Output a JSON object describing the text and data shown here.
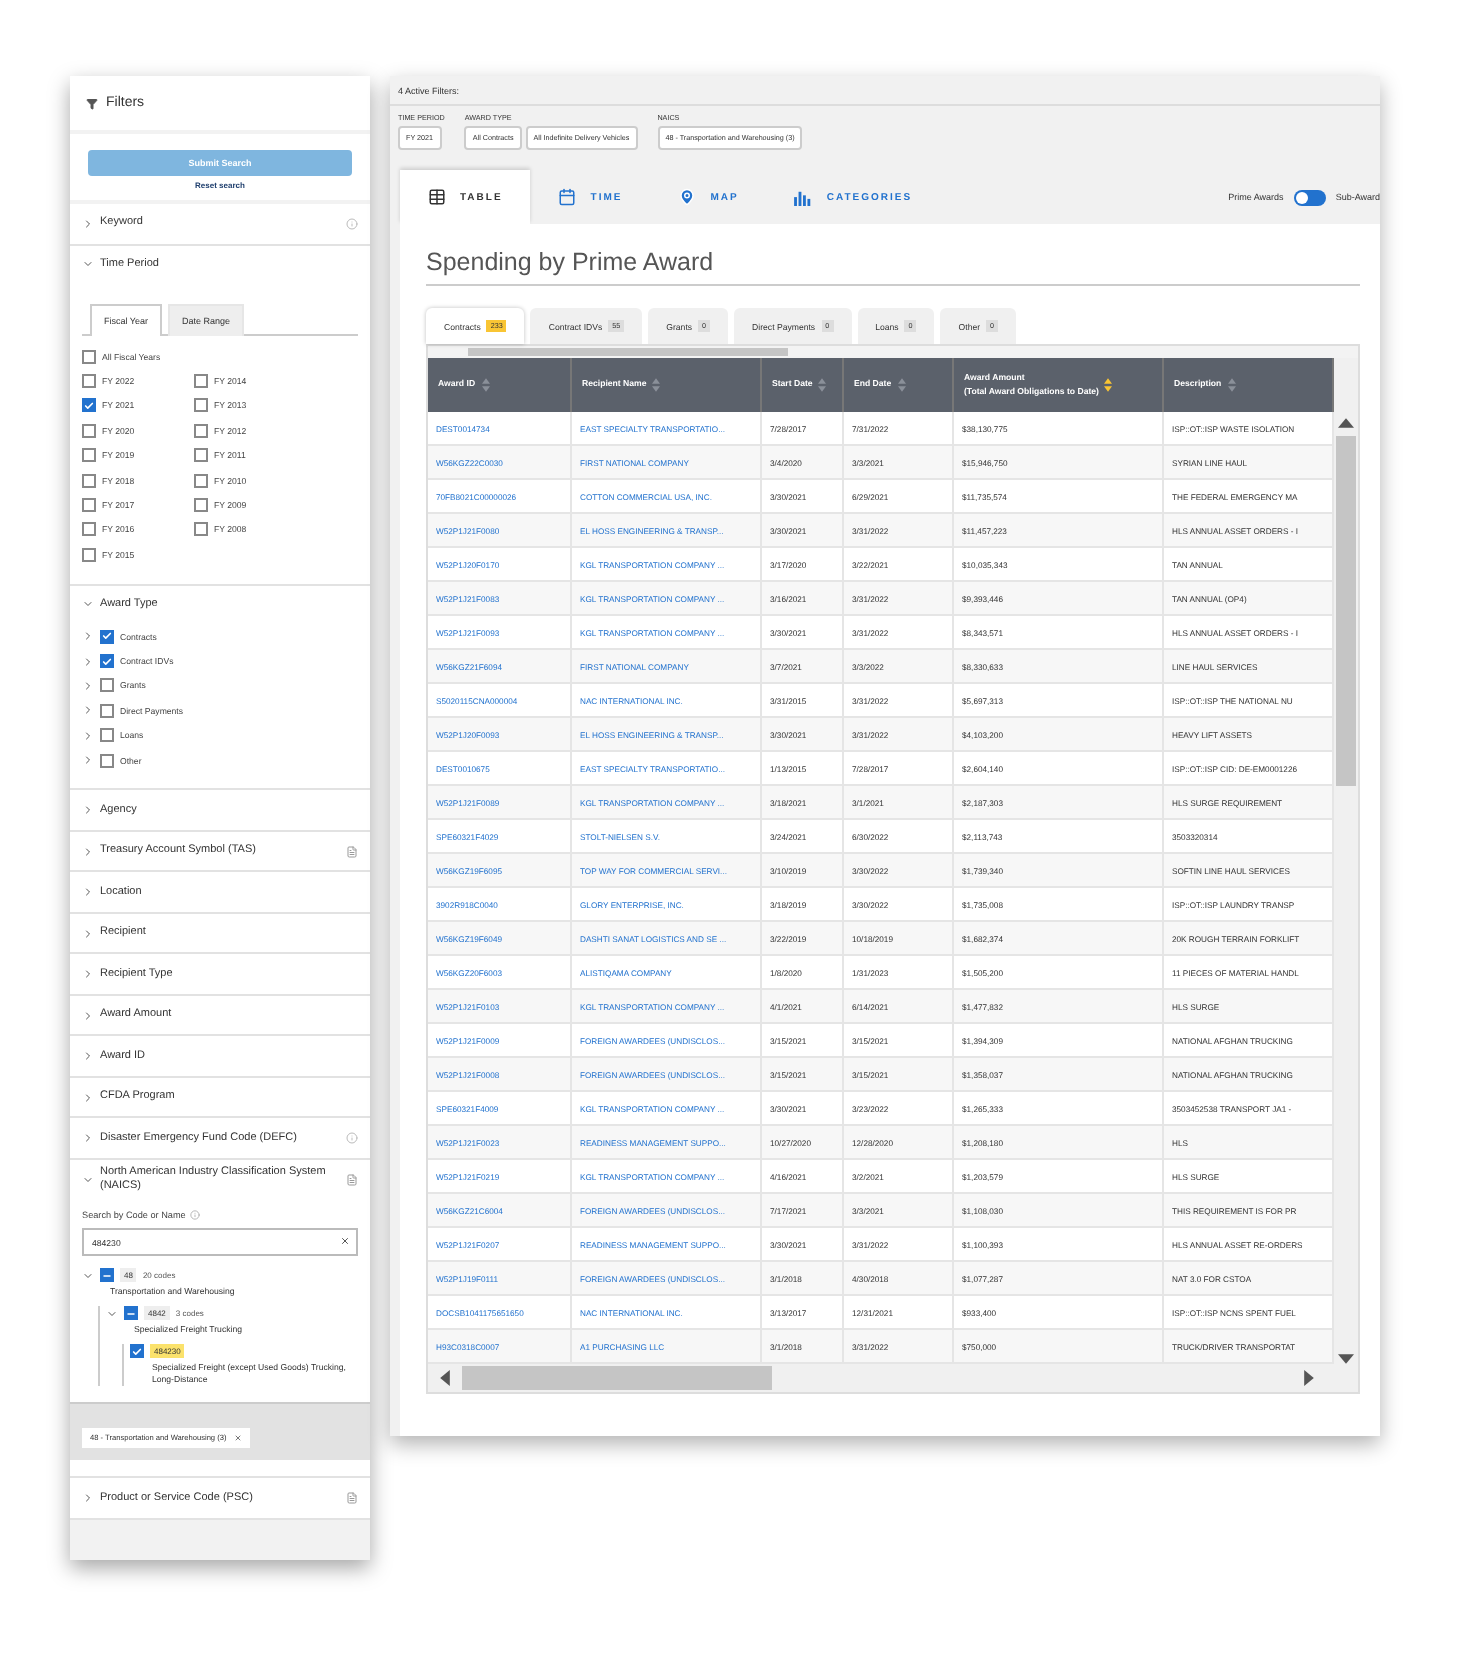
{
  "sidebar": {
    "title": "Filters",
    "submit_button": "Submit Search",
    "reset_link": "Reset search",
    "sections": [
      {
        "title": "Keyword",
        "expanded": false,
        "info_icon": true
      },
      {
        "kind": "time_period",
        "title": "Time Period",
        "expanded": true,
        "tabs": [
          {
            "label": "Fiscal Year",
            "selected": true
          },
          {
            "label": "Date Range",
            "selected": false
          }
        ],
        "all": {
          "label": "All Fiscal Years",
          "checked": false
        },
        "years": [
          {
            "label": "FY 2022",
            "checked": false
          },
          {
            "label": "FY 2021",
            "checked": true
          },
          {
            "label": "FY 2020",
            "checked": false
          },
          {
            "label": "FY 2019",
            "checked": false
          },
          {
            "label": "FY 2018",
            "checked": false
          },
          {
            "label": "FY 2017",
            "checked": false
          },
          {
            "label": "FY 2016",
            "checked": false
          },
          {
            "label": "FY 2015",
            "checked": false
          },
          {
            "label": "FY 2014",
            "checked": false
          },
          {
            "label": "FY 2013",
            "checked": false
          },
          {
            "label": "FY 2012",
            "checked": false
          },
          {
            "label": "FY 2011",
            "checked": false
          },
          {
            "label": "FY 2010",
            "checked": false
          },
          {
            "label": "FY 2009",
            "checked": false
          },
          {
            "label": "FY 2008",
            "checked": false
          }
        ]
      },
      {
        "kind": "award_type",
        "title": "Award Type",
        "expanded": true,
        "items": [
          {
            "label": "Contracts",
            "checked": true
          },
          {
            "label": "Contract IDVs",
            "checked": true
          },
          {
            "label": "Grants",
            "checked": false
          },
          {
            "label": "Direct Payments",
            "checked": false
          },
          {
            "label": "Loans",
            "checked": false
          },
          {
            "label": "Other",
            "checked": false
          }
        ]
      },
      {
        "title": "Agency",
        "expanded": false
      },
      {
        "title": "Treasury Account Symbol (TAS)",
        "expanded": false,
        "doc_icon": true
      },
      {
        "title": "Location",
        "expanded": false
      },
      {
        "title": "Recipient",
        "expanded": false
      },
      {
        "title": "Recipient Type",
        "expanded": false
      },
      {
        "title": "Award Amount",
        "expanded": false
      },
      {
        "title": "Award ID",
        "expanded": false
      },
      {
        "title": "CFDA Program",
        "expanded": false
      },
      {
        "title": "Disaster Emergency Fund Code (DEFC)",
        "expanded": false,
        "info_icon": true
      },
      {
        "kind": "naics",
        "title": "North American Industry Classification System (NAICS)",
        "expanded": true,
        "doc_icon": true,
        "search_label": "Search by Code or Name",
        "search_value": "484230",
        "tree": [
          {
            "code": "48",
            "count": "20 codes",
            "name": "Transportation and Warehousing",
            "indeterminate": true,
            "expanded": true,
            "children": [
              {
                "code": "4842",
                "count": "3 codes",
                "name": "Specialized Freight Trucking",
                "indeterminate": true,
                "expanded": true,
                "children": [
                  {
                    "code": "484230",
                    "name": "Specialized Freight (except Used Goods) Trucking, Long-Distance",
                    "checked": true,
                    "highlighted": true
                  }
                ]
              }
            ]
          }
        ],
        "chips": [
          "48 - Transportation and Warehousing (3)"
        ]
      },
      {
        "title": "Product or Service Code (PSC)",
        "expanded": false,
        "doc_icon": true
      }
    ]
  },
  "active_filters": {
    "title": "4 Active Filters:",
    "groups": [
      {
        "label": "TIME PERIOD",
        "chips": [
          "FY 2021"
        ]
      },
      {
        "label": "AWARD TYPE",
        "chips": [
          "All Contracts",
          "All Indefinite Delivery Vehicles"
        ]
      },
      {
        "label": "NAICS",
        "chips": [
          "48 - Transportation and Warehousing (3)"
        ]
      }
    ]
  },
  "view_tabs": [
    {
      "label": "TABLE",
      "kind": "table",
      "selected": true
    },
    {
      "label": "TIME",
      "kind": "time",
      "selected": false
    },
    {
      "label": "MAP",
      "kind": "map",
      "selected": false
    },
    {
      "label": "CATEGORIES",
      "kind": "categories",
      "selected": false
    }
  ],
  "award_toggle": {
    "left": "Prime Awards",
    "right": "Sub-Award",
    "sub_selected": false
  },
  "heading": "Spending by Prime Award",
  "award_tabs": [
    {
      "label": "Contracts",
      "count": "233",
      "selected": true
    },
    {
      "label": "Contract IDVs",
      "count": "55",
      "selected": false
    },
    {
      "label": "Grants",
      "count": "0",
      "selected": false
    },
    {
      "label": "Direct Payments",
      "count": "0",
      "selected": false
    },
    {
      "label": "Loans",
      "count": "0",
      "selected": false
    },
    {
      "label": "Other",
      "count": "0",
      "selected": false
    }
  ],
  "table": {
    "columns": [
      {
        "label": "Award ID",
        "kind": "link",
        "sorted": false
      },
      {
        "label": "Recipient Name",
        "kind": "link",
        "sorted": false
      },
      {
        "label": "Start Date",
        "kind": "text",
        "sorted": false
      },
      {
        "label": "End Date",
        "kind": "text",
        "sorted": false
      },
      {
        "label": "Award Amount",
        "sublabel": "(Total Award Obligations to Date)",
        "kind": "text",
        "sorted": true
      },
      {
        "label": "Description",
        "kind": "text",
        "sorted": false
      }
    ],
    "rows": [
      [
        "DEST0014734",
        "EAST SPECIALTY TRANSPORTATIO...",
        "7/28/2017",
        "7/31/2022",
        "$38,130,775",
        "ISP::OT::ISP WASTE ISOLATION"
      ],
      [
        "W56KGZ22C0030",
        "FIRST NATIONAL COMPANY",
        "3/4/2020",
        "3/3/2021",
        "$15,946,750",
        "SYRIAN LINE HAUL"
      ],
      [
        "70FB8021C00000026",
        "COTTON COMMERCIAL USA, INC.",
        "3/30/2021",
        "6/29/2021",
        "$11,735,574",
        "THE FEDERAL EMERGENCY MA"
      ],
      [
        "W52P1J21F0080",
        "EL HOSS ENGINEERING & TRANSP...",
        "3/30/2021",
        "3/31/2022",
        "$11,457,223",
        "HLS ANNUAL ASSET ORDERS - I"
      ],
      [
        "W52P1J20F0170",
        "KGL TRANSPORTATION COMPANY ...",
        "3/17/2020",
        "3/22/2021",
        "$10,035,343",
        "TAN ANNUAL"
      ],
      [
        "W52P1J21F0083",
        "KGL TRANSPORTATION COMPANY ...",
        "3/16/2021",
        "3/31/2022",
        "$9,393,446",
        "TAN ANNUAL (OP4)"
      ],
      [
        "W52P1J21F0093",
        "KGL TRANSPORTATION COMPANY ...",
        "3/30/2021",
        "3/31/2022",
        "$8,343,571",
        "HLS ANNUAL ASSET ORDERS - I"
      ],
      [
        "W56KGZ21F6094",
        "FIRST NATIONAL COMPANY",
        "3/7/2021",
        "3/3/2022",
        "$8,330,633",
        "LINE HAUL SERVICES"
      ],
      [
        "S5020115CNA000004",
        "NAC INTERNATIONAL INC.",
        "3/31/2015",
        "3/31/2022",
        "$5,697,313",
        "ISP::OT::ISP THE NATIONAL NU"
      ],
      [
        "W52P1J20F0093",
        "EL HOSS ENGINEERING & TRANSP...",
        "3/30/2021",
        "3/31/2022",
        "$4,103,200",
        "HEAVY LIFT ASSETS"
      ],
      [
        "DEST0010675",
        "EAST SPECIALTY TRANSPORTATIO...",
        "1/13/2015",
        "7/28/2017",
        "$2,604,140",
        "ISP::OT::ISP CID: DE-EM0001226"
      ],
      [
        "W52P1J21F0089",
        "KGL TRANSPORTATION COMPANY ...",
        "3/18/2021",
        "3/1/2021",
        "$2,187,303",
        "HLS SURGE REQUIREMENT"
      ],
      [
        "SPE60321F4029",
        "STOLT-NIELSEN S.V.",
        "3/24/2021",
        "6/30/2022",
        "$2,113,743",
        "3503320314"
      ],
      [
        "W56KGZ19F6095",
        "TOP WAY FOR COMMERCIAL SERVI...",
        "3/10/2019",
        "3/30/2022",
        "$1,739,340",
        "SOFTIN LINE HAUL SERVICES"
      ],
      [
        "3902R918C0040",
        "GLORY ENTERPRISE, INC.",
        "3/18/2019",
        "3/30/2022",
        "$1,735,008",
        "ISP::OT::ISP LAUNDRY TRANSP"
      ],
      [
        "W56KGZ19F6049",
        "DASHTI SANAT LOGISTICS AND SE ...",
        "3/22/2019",
        "10/18/2019",
        "$1,682,374",
        "20K ROUGH TERRAIN FORKLIFT"
      ],
      [
        "W56KGZ20F6003",
        "ALISTIQAMA COMPANY",
        "1/8/2020",
        "1/31/2023",
        "$1,505,200",
        "11 PIECES OF MATERIAL HANDL"
      ],
      [
        "W52P1J21F0103",
        "KGL TRANSPORTATION COMPANY ...",
        "4/1/2021",
        "6/14/2021",
        "$1,477,832",
        "HLS SURGE"
      ],
      [
        "W52P1J21F0009",
        "FOREIGN AWARDEES (UNDISCLOS...",
        "3/15/2021",
        "3/15/2021",
        "$1,394,309",
        "NATIONAL AFGHAN TRUCKING"
      ],
      [
        "W52P1J21F0008",
        "FOREIGN AWARDEES (UNDISCLOS...",
        "3/15/2021",
        "3/15/2021",
        "$1,358,037",
        "NATIONAL AFGHAN TRUCKING"
      ],
      [
        "SPE60321F4009",
        "KGL TRANSPORTATION COMPANY ...",
        "3/30/2021",
        "3/23/2022",
        "$1,265,333",
        "3503452538 TRANSPORT JA1 -"
      ],
      [
        "W52P1J21F0023",
        "READINESS MANAGEMENT SUPPO...",
        "10/27/2020",
        "12/28/2020",
        "$1,208,180",
        "HLS"
      ],
      [
        "W52P1J21F0219",
        "KGL TRANSPORTATION COMPANY ...",
        "4/16/2021",
        "3/2/2021",
        "$1,203,579",
        "HLS SURGE"
      ],
      [
        "W56KGZ21C6004",
        "FOREIGN AWARDEES (UNDISCLOS...",
        "7/17/2021",
        "3/3/2021",
        "$1,108,030",
        "THIS REQUIREMENT IS FOR PR"
      ],
      [
        "W52P1J21F0207",
        "READINESS MANAGEMENT SUPPO...",
        "3/30/2021",
        "3/31/2022",
        "$1,100,393",
        "HLS ANNUAL ASSET RE-ORDERS"
      ],
      [
        "W52P1J19F0111",
        "FOREIGN AWARDEES (UNDISCLOS...",
        "3/1/2018",
        "4/30/2018",
        "$1,077,287",
        "NAT 3.0 FOR CSTOA"
      ],
      [
        "DOCSB1041175651650",
        "NAC INTERNATIONAL INC.",
        "3/13/2017",
        "12/31/2021",
        "$933,400",
        "ISP::OT::ISP NCNS SPENT FUEL"
      ],
      [
        "H93C0318C0007",
        "A1 PURCHASING LLC",
        "3/1/2018",
        "3/31/2022",
        "$750,000",
        "TRUCK/DRIVER TRANSPORTAT"
      ]
    ]
  }
}
